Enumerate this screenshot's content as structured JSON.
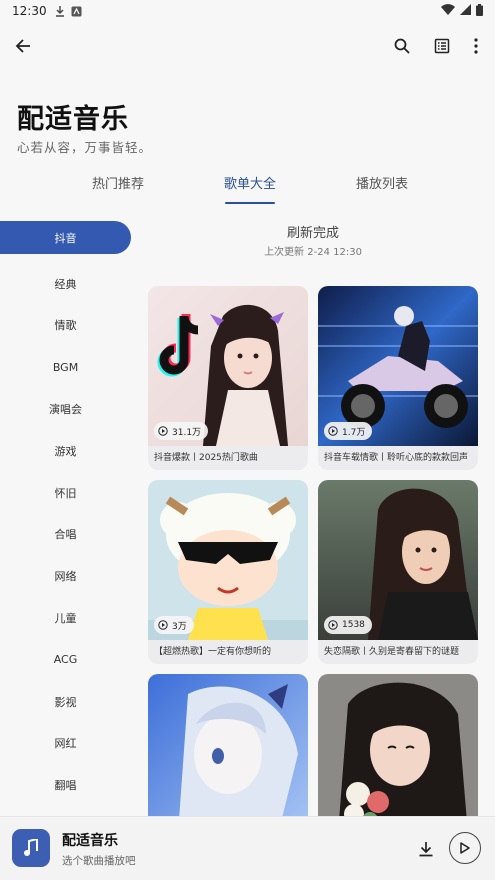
{
  "status": {
    "time": "12:30"
  },
  "header": {
    "title": "配适音乐",
    "subtitle": "心若从容，万事皆轻。"
  },
  "tabs": [
    {
      "label": "热门推荐",
      "active": false
    },
    {
      "label": "歌单大全",
      "active": true
    },
    {
      "label": "播放列表",
      "active": false
    }
  ],
  "sidebar": {
    "items": [
      {
        "label": "抖音",
        "active": true
      },
      {
        "label": "经典"
      },
      {
        "label": "情歌"
      },
      {
        "label": "BGM"
      },
      {
        "label": "演唱会"
      },
      {
        "label": "游戏"
      },
      {
        "label": "怀旧"
      },
      {
        "label": "合唱"
      },
      {
        "label": "网络"
      },
      {
        "label": "儿童"
      },
      {
        "label": "ACG"
      },
      {
        "label": "影视"
      },
      {
        "label": "网红"
      },
      {
        "label": "翻唱"
      }
    ]
  },
  "refresh": {
    "title": "刷新完成",
    "updated": "上次更新 2-24 12:30"
  },
  "playlists": [
    {
      "plays": "31.1万",
      "title": "抖音爆款丨2025热门歌曲"
    },
    {
      "plays": "1.7万",
      "title": "抖音车载情歌丨聆听心底的款款回声"
    },
    {
      "plays": "3万",
      "title": "【超燃热歌】一定有你想听的"
    },
    {
      "plays": "1538",
      "title": "失恋隔歌丨久别是寄春留下的谜题"
    },
    {
      "plays": "",
      "title": ""
    },
    {
      "plays": "",
      "title": ""
    }
  ],
  "player": {
    "title": "配适音乐",
    "subtitle": "选个歌曲播放吧"
  },
  "colors": {
    "accent": "#2a4ea0",
    "sidebar_active": "#3459b0",
    "player_art": "#3c5fb4"
  }
}
